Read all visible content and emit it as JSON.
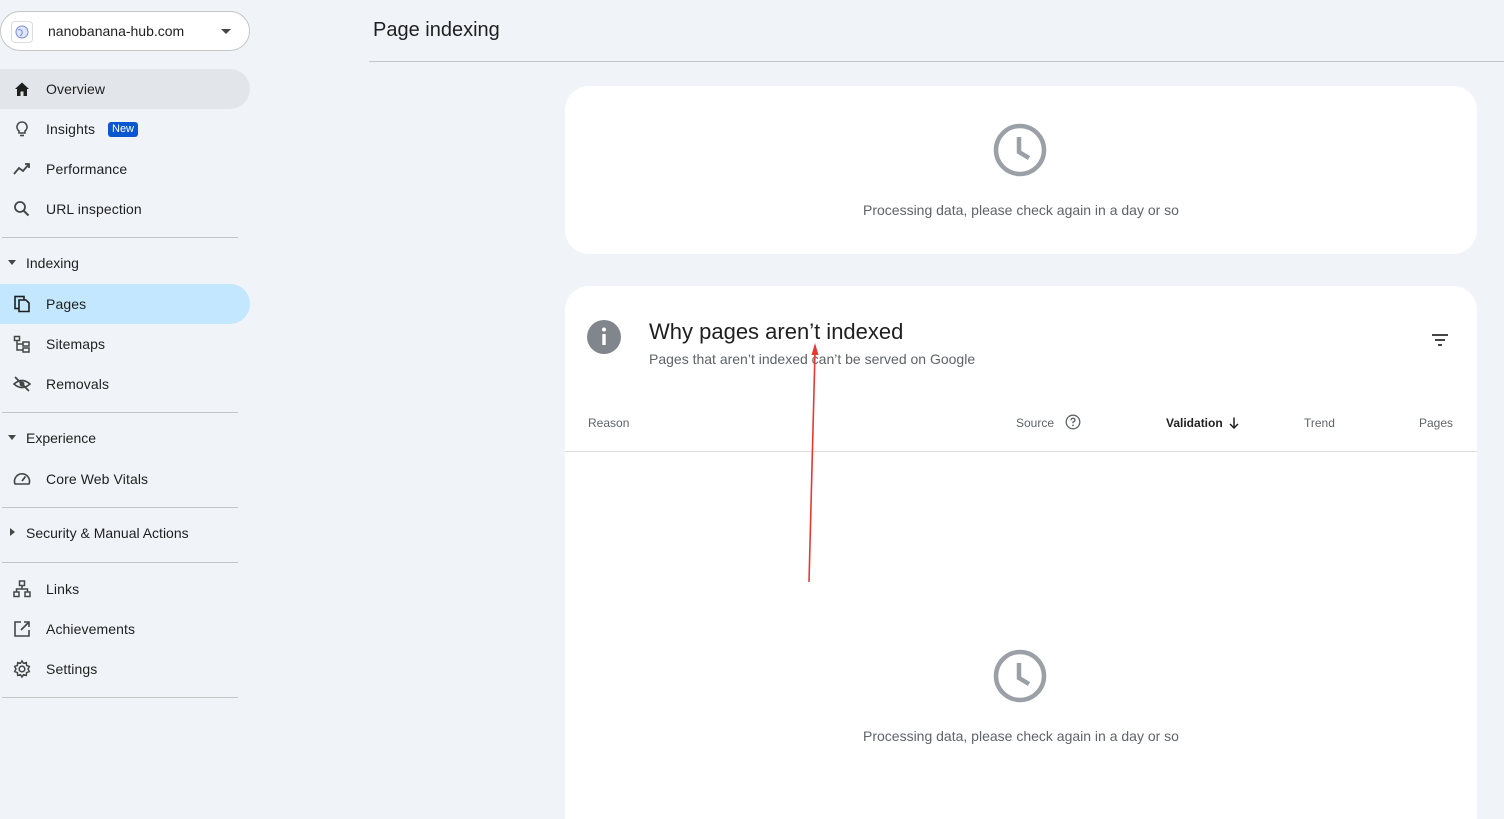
{
  "property": {
    "name": "nanobanana-hub.com"
  },
  "nav": {
    "overview": "Overview",
    "insights": "Insights",
    "insights_badge": "New",
    "performance": "Performance",
    "url_inspection": "URL inspection",
    "indexing_section": "Indexing",
    "pages": "Pages",
    "sitemaps": "Sitemaps",
    "removals": "Removals",
    "experience_section": "Experience",
    "core_web_vitals": "Core Web Vitals",
    "security_section": "Security & Manual Actions",
    "links": "Links",
    "achievements": "Achievements",
    "settings": "Settings"
  },
  "header": {
    "title": "Page indexing"
  },
  "summary_card": {
    "status": "Processing data, please check again in a day or so"
  },
  "reasons_card": {
    "title": "Why pages aren’t indexed",
    "subtitle": "Pages that aren’t indexed can’t be served on Google",
    "columns": {
      "reason": "Reason",
      "source": "Source",
      "validation": "Validation",
      "trend": "Trend",
      "pages": "Pages"
    },
    "status": "Processing data, please check again in a day or so"
  },
  "colors": {
    "active_blue": "#c2e7ff",
    "active_grey": "#e2e5e9",
    "badge": "#0b57d0",
    "annotation_arrow": "#e53935"
  }
}
